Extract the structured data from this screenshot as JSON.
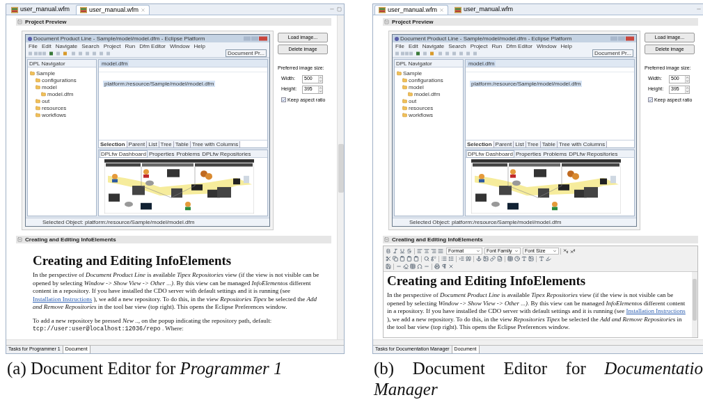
{
  "panels": [
    {
      "caption": "(a) Document Editor for *Programmer 1*",
      "editor_tabs": [
        {
          "label": "user_manual.wfm",
          "selected": false,
          "closable": false
        },
        {
          "label": "user_manual.wfm",
          "selected": true,
          "closable": true
        }
      ],
      "preview": {
        "header": "Project Preview",
        "screenshot": {
          "title": "Document Product Line - Sample/model/model.dfm - Eclipse Platform",
          "menu": [
            "File",
            "Edit",
            "Navigate",
            "Search",
            "Project",
            "Run",
            "Dfm Editor",
            "Window",
            "Help"
          ],
          "perspective": "Document Pr...",
          "navigator_title": "DPL Navigator",
          "tree": [
            {
              "label": "Sample",
              "children": [
                {
                  "label": "configurations"
                },
                {
                  "label": "model",
                  "children": [
                    {
                      "label": "model.dfm"
                    }
                  ]
                },
                {
                  "label": "out"
                },
                {
                  "label": "resources"
                },
                {
                  "label": "workflows"
                }
              ]
            }
          ],
          "editor_tab": "model.dfm",
          "resource": "platform:/resource/Sample/model/model.dfm",
          "view_tabs": [
            {
              "label": "Selection",
              "selected": true
            },
            {
              "label": "Parent",
              "selected": false
            },
            {
              "label": "List",
              "selected": false
            },
            {
              "label": "Tree",
              "selected": false
            },
            {
              "label": "Table",
              "selected": false
            },
            {
              "label": "Tree with Columns",
              "selected": false
            }
          ],
          "dashboard_tabs": [
            {
              "label": "DPLfw Dashboard",
              "selected": true
            },
            {
              "label": "Properties",
              "selected": false
            },
            {
              "label": "Problems",
              "selected": false
            },
            {
              "label": "DPLfw Repositories",
              "selected": false
            }
          ],
          "status": "Selected Object: platform:/resource/Sample/model/model.dfm"
        },
        "buttons": [
          "Load image...",
          "Delete image"
        ],
        "size_label": "Preferred image size:",
        "width": {
          "label": "Width:",
          "value": "500"
        },
        "height": {
          "label": "Height:",
          "value": "395"
        },
        "keep_aspect": {
          "label": "Keep aspect ratio",
          "checked": true
        }
      },
      "section": {
        "header": "Creating and Editing InfoElements",
        "kind": "viewer",
        "heading": "Creating and Editing InfoElements",
        "paragraphs": [
          [
            {
              "kind": "text",
              "text": "In the perspective of *Document Product Line* is available *Tipex Repositories* view (if the view is not visible can be opened by selecting *Window -> Show View -> Other ...)*. By this view can be managed *InfoElementos* different content in a repository. If you have installed the CDO server with default settings and it is running (see "
            },
            {
              "kind": "link",
              "text": "Installation Instructions"
            },
            {
              "kind": "text",
              "text": " ), we add a new repository. To do this, in the view *Repositories Tipex* be selected the *Add and Remove Repositories* in the tool bar view (top right). This opens the Eclipse Preferences window."
            }
          ],
          [
            {
              "kind": "text",
              "text": "To add a new repository be pressed *New ..*, on the popup indicating the repository path, default: "
            },
            {
              "kind": "code",
              "text": "tcp://user:user@localhost:12036/repo"
            },
            {
              "kind": "text",
              "text": " . Where:"
            }
          ]
        ]
      },
      "bottom_tabs": [
        {
          "label": "Tasks for Programmer 1",
          "selected": false
        },
        {
          "label": "Document",
          "selected": true
        }
      ]
    },
    {
      "caption": "(b) Document Editor for *Documentatio Manager*",
      "editor_tabs": [
        {
          "label": "user_manual.wfm",
          "selected": true,
          "closable": true
        },
        {
          "label": "user_manual.wfm",
          "selected": false,
          "closable": false
        }
      ],
      "preview": {
        "header": "Project Preview",
        "screenshot": {
          "title": "Document Product Line - Sample/model/model.dfm - Eclipse Platform",
          "menu": [
            "File",
            "Edit",
            "Navigate",
            "Search",
            "Project",
            "Run",
            "Dfm Editor",
            "Window",
            "Help"
          ],
          "perspective": "Document Pr...",
          "navigator_title": "DPL Navigator",
          "tree": [
            {
              "label": "Sample",
              "children": [
                {
                  "label": "configurations"
                },
                {
                  "label": "model",
                  "children": [
                    {
                      "label": "model.dfm"
                    }
                  ]
                },
                {
                  "label": "out"
                },
                {
                  "label": "resources"
                },
                {
                  "label": "workflows"
                }
              ]
            }
          ],
          "editor_tab": "model.dfm",
          "resource": "platform:/resource/Sample/model/model.dfm",
          "view_tabs": [
            {
              "label": "Selection",
              "selected": true
            },
            {
              "label": "Parent",
              "selected": false
            },
            {
              "label": "List",
              "selected": false
            },
            {
              "label": "Tree",
              "selected": false
            },
            {
              "label": "Table",
              "selected": false
            },
            {
              "label": "Tree with Columns",
              "selected": false
            }
          ],
          "dashboard_tabs": [
            {
              "label": "DPLfw Dashboard",
              "selected": true
            },
            {
              "label": "Properties",
              "selected": false
            },
            {
              "label": "Problems",
              "selected": false
            },
            {
              "label": "DPLfw Repositories",
              "selected": false
            }
          ],
          "status": "Selected Object: platform:/resource/Sample/model/model.dfm"
        },
        "buttons": [
          "Load image...",
          "Delete image"
        ],
        "size_label": "Preferred image size:",
        "width": {
          "label": "Width:",
          "value": "500"
        },
        "height": {
          "label": "Height:",
          "value": "395"
        },
        "keep_aspect": {
          "label": "Keep aspect ratio",
          "checked": true
        }
      },
      "section": {
        "header": "Creating and Editing InfoElements",
        "kind": "editor",
        "toolbar_dropdowns": [
          "Format",
          "Font Family",
          "Font Size"
        ],
        "heading": "Creating and Editing InfoElements",
        "paragraphs": [
          [
            {
              "kind": "text",
              "text": "In the perspective of *Document Product Line* is available *Tipex Repositories* view (if the view is not visible can be opened by selecting *Window -> Show View -> Other ...)*. By this view can be managed *InfoElementos* different content in a repository. If you have installed the CDO server with default settings and it is running (see "
            },
            {
              "kind": "link",
              "text": "Installation Instructions"
            },
            {
              "kind": "text",
              "text": " ), we add a new repository. To do this, in the view *Repositories Tipex* be selected the *Add and Remove Repositories* in the tool bar view (top right). This opens the Eclipse Preferences window."
            }
          ]
        ]
      },
      "bottom_tabs": [
        {
          "label": "Tasks for Documentation Manager",
          "selected": false
        },
        {
          "label": "Document",
          "selected": true
        }
      ]
    }
  ]
}
